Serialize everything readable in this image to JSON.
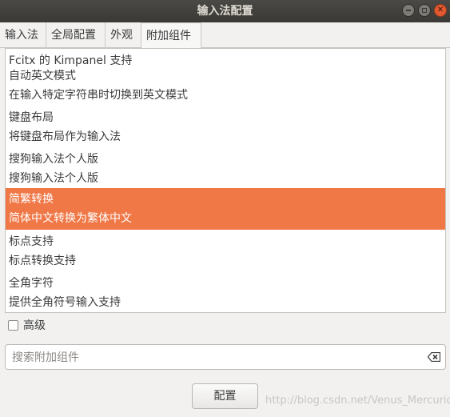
{
  "window": {
    "title": "输入法配置"
  },
  "tabs": [
    {
      "label": "输入法"
    },
    {
      "label": "全局配置"
    },
    {
      "label": "外观"
    },
    {
      "label": "附加组件",
      "active": true
    }
  ],
  "addons": [
    {
      "name": "",
      "desc": "Fcitx 的 Kimpanel 支持"
    },
    {
      "name": "自动英文模式",
      "desc": "在输入特定字符串时切换到英文模式"
    },
    {
      "name": "键盘布局",
      "desc": "将键盘布局作为输入法"
    },
    {
      "name": "搜狗输入法个人版",
      "desc": "搜狗输入法个人版"
    },
    {
      "name": "简繁转换",
      "desc": "简体中文转换为繁体中文",
      "selected": true
    },
    {
      "name": "标点支持",
      "desc": "标点转换支持"
    },
    {
      "name": "全角字符",
      "desc": "提供全角符号输入支持"
    }
  ],
  "advanced": {
    "label": "高级",
    "checked": false
  },
  "search": {
    "placeholder": "搜索附加组件",
    "value": ""
  },
  "buttons": {
    "configure": "配置"
  },
  "watermark": "http://blog.csdn.net/Venus_Mercurio",
  "colors": {
    "selection": "#f07746",
    "titlebar": "#3c3b37",
    "close": "#e2582f"
  },
  "icons": {
    "clear": "edit-clear-icon",
    "close": "close-icon",
    "maximize": "maximize-icon",
    "minimize": "minimize-icon"
  }
}
